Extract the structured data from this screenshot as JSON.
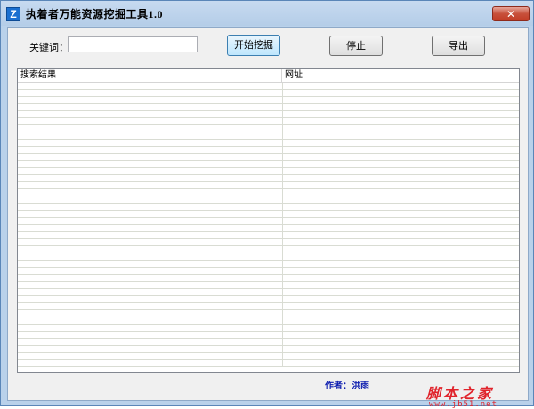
{
  "window": {
    "title": "执着者万能资源挖掘工具1.0",
    "icon_letter": "Z",
    "close_symbol": "✕"
  },
  "toolbar": {
    "keyword_label": "关键词：",
    "keyword_value": "",
    "start_label": "开始挖掘",
    "stop_label": "停止",
    "export_label": "导出"
  },
  "results": {
    "columns": [
      "搜索结果",
      "网址"
    ],
    "rows": []
  },
  "footer": {
    "author": "作者：洪雨"
  },
  "watermark": {
    "text": "脚本之家",
    "url": "www.jb51.net"
  },
  "colors": {
    "accent": "#1a6fd0",
    "author_text": "#0f1fb0",
    "watermark": "#e0232b"
  }
}
